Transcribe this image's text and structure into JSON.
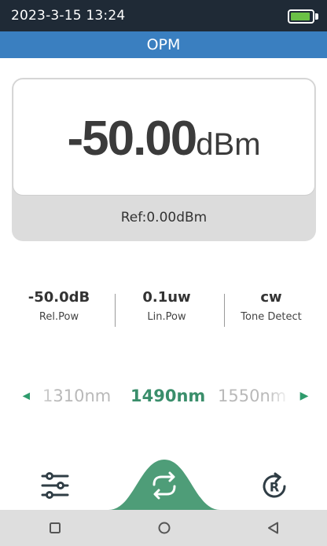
{
  "status_bar": {
    "time": "2023-3-15 13:24",
    "battery_icon": "battery-icon",
    "battery_color": "#6ac046"
  },
  "header": {
    "title": "OPM"
  },
  "reading": {
    "value": "-50.00",
    "unit": "dBm",
    "reference": "Ref:0.00dBm"
  },
  "stats": [
    {
      "value": "-50.0dB",
      "label": "Rel.Pow"
    },
    {
      "value": "0.1uw",
      "label": "Lin.Pow"
    },
    {
      "value": "cw",
      "label": "Tone Detect"
    }
  ],
  "wavelengths": {
    "previous": "1310nm",
    "selected": "1490nm",
    "next": "1550nm"
  },
  "toolbar": {
    "left_icon": "sliders-icon",
    "center_icon": "switch-icon",
    "right_icon": "reference-reset-icon"
  },
  "nav": {
    "back_icon": "back-triangle-icon",
    "home_icon": "home-circle-icon",
    "recents_icon": "recents-square-icon"
  },
  "colors": {
    "status_bg": "#1f2a36",
    "header_bg": "#3a7fc0",
    "accent": "#3a8e6b",
    "card_bg": "#dcdcdc",
    "nav_bg": "#dedede"
  }
}
